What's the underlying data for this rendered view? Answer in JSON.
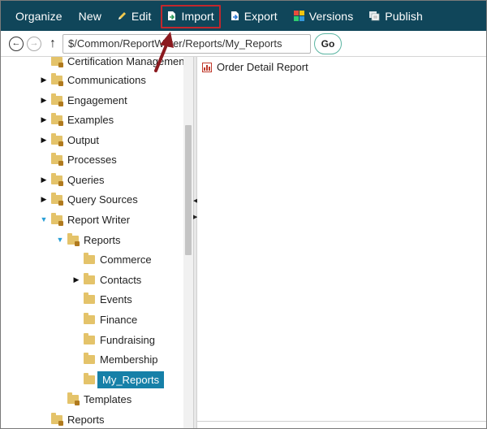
{
  "toolbar": {
    "items": [
      {
        "label": "Organize",
        "icon": ""
      },
      {
        "label": "New",
        "icon": ""
      },
      {
        "label": "Edit",
        "icon": "pencil-icon"
      },
      {
        "label": "Import",
        "icon": "import-icon"
      },
      {
        "label": "Export",
        "icon": "export-icon"
      },
      {
        "label": "Versions",
        "icon": "versions-icon"
      },
      {
        "label": "Publish",
        "icon": "publish-icon"
      }
    ]
  },
  "address": {
    "path": "$/Common/ReportWriter/Reports/My_Reports",
    "go_label": "Go"
  },
  "tree": {
    "items": [
      {
        "label": "Certification Management",
        "level": 0,
        "expander": "",
        "locked": true
      },
      {
        "label": "Communications",
        "level": 0,
        "expander": "closed",
        "locked": true
      },
      {
        "label": "Engagement",
        "level": 0,
        "expander": "closed",
        "locked": true
      },
      {
        "label": "Examples",
        "level": 0,
        "expander": "closed",
        "locked": true
      },
      {
        "label": "Output",
        "level": 0,
        "expander": "closed",
        "locked": true
      },
      {
        "label": "Processes",
        "level": 0,
        "expander": "",
        "locked": true
      },
      {
        "label": "Queries",
        "level": 0,
        "expander": "closed",
        "locked": true
      },
      {
        "label": "Query Sources",
        "level": 0,
        "expander": "closed",
        "locked": true
      },
      {
        "label": "Report Writer",
        "level": 0,
        "expander": "open",
        "locked": true
      },
      {
        "label": "Reports",
        "level": 1,
        "expander": "open",
        "locked": true
      },
      {
        "label": "Commerce",
        "level": 2,
        "expander": "",
        "locked": false
      },
      {
        "label": "Contacts",
        "level": 2,
        "expander": "closed",
        "locked": false
      },
      {
        "label": "Events",
        "level": 2,
        "expander": "",
        "locked": false
      },
      {
        "label": "Finance",
        "level": 2,
        "expander": "",
        "locked": false
      },
      {
        "label": "Fundraising",
        "level": 2,
        "expander": "",
        "locked": false
      },
      {
        "label": "Membership",
        "level": 2,
        "expander": "",
        "locked": false
      },
      {
        "label": "My_Reports",
        "level": 2,
        "expander": "",
        "locked": false,
        "selected": true
      },
      {
        "label": "Templates",
        "level": 1,
        "expander": "",
        "locked": true
      },
      {
        "label": "Reports",
        "level": 0,
        "expander": "",
        "locked": true
      }
    ]
  },
  "content": {
    "items": [
      {
        "label": "Order Detail Report",
        "icon": "report-chart-icon"
      }
    ]
  },
  "colors": {
    "toolbar_bg": "#10465a",
    "highlight_border": "#c2272d",
    "selected_bg": "#1680a8",
    "arrow": "#8b1a1f"
  }
}
